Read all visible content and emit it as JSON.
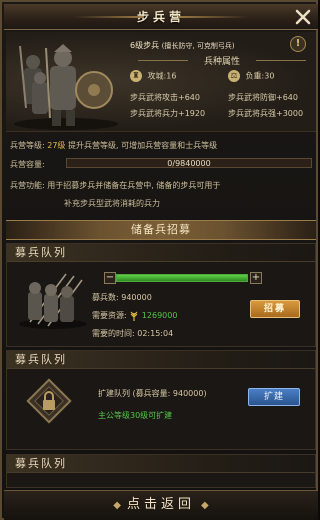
{
  "window": {
    "title": "步兵营",
    "close_icon": "close-x-icon"
  },
  "unit": {
    "name": "6级步兵",
    "note": "(擅长防守, 可克制弓兵)",
    "attributes_title": "兵种属性",
    "stats": [
      {
        "icon": "siege-icon",
        "label": "攻城:",
        "value": "16"
      },
      {
        "icon": "weight-icon",
        "label": "负重:",
        "value": "30"
      }
    ],
    "bonuses": [
      {
        "label": "步兵武将攻击",
        "value": "+640"
      },
      {
        "label": "步兵武将防御",
        "value": "+640"
      },
      {
        "label": "步兵武将兵力",
        "value": "+1920"
      },
      {
        "label": "步兵武将兵强",
        "value": "+3000"
      }
    ]
  },
  "camp": {
    "level_label": "兵营等级:",
    "level_value": "27级",
    "level_desc": "提升兵营等级, 可增加兵营容量和士兵等级",
    "capacity_label": "兵营容量:",
    "capacity_text": "0/9840000",
    "capacity_fraction": 0,
    "function_label": "兵营功能:",
    "function_desc_1": "用于招募步兵并储备在兵营中, 储备的步兵可用于",
    "function_desc_2": "补充步兵型武将消耗的兵力"
  },
  "reserve_banner": "储备兵招募",
  "queue1": {
    "title": "募兵队列",
    "minus": "−",
    "plus": "+",
    "slider_fraction": 1.0,
    "count_label": "募兵数:",
    "count_value": "940000",
    "resource_label": "需要资源:",
    "resource_value": "1269000",
    "time_label": "需要的时间:",
    "time_value": "02:15:04",
    "recruit_button": "招募"
  },
  "queue2": {
    "title": "募兵队列",
    "expand_label": "扩建队列",
    "capacity_note": "(募兵容量: 940000)",
    "requirement": "主公等级30级可扩建",
    "expand_button": "扩建",
    "lock_icon": "lock-icon"
  },
  "queue3": {
    "title": "募兵队列"
  },
  "footer": {
    "back_label": "点击返回"
  },
  "colors": {
    "gold": "#e5b84a",
    "green": "#55c44a",
    "orange_button": "#c98530",
    "blue_button": "#3a6aaa"
  }
}
